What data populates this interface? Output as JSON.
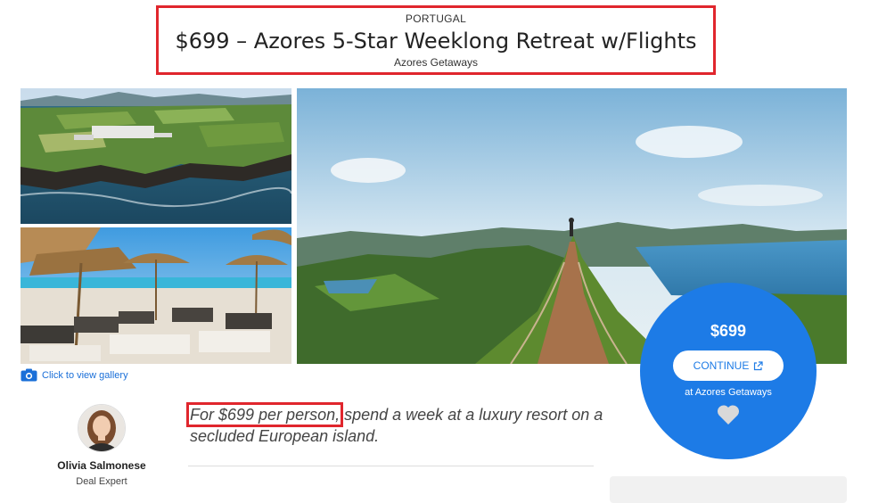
{
  "header": {
    "country": "PORTUGAL",
    "title": "$699 – Azores 5-Star Weeklong Retreat w/Flights",
    "provider": "Azores Getaways"
  },
  "gallery": {
    "link_label": "Click to view gallery",
    "icon": "camera-icon",
    "photos": [
      "aerial-coast-resort-photo",
      "pool-umbrellas-photo",
      "crater-lake-trail-photo"
    ]
  },
  "deal": {
    "price": "$699",
    "continue_label": "CONTINUE",
    "continue_icon": "external-link-icon",
    "at_label": "at Azores Getaways",
    "heart_icon": "heart-icon",
    "color": "#1d7be6"
  },
  "author": {
    "name": "Olivia Salmonese",
    "role": "Deal Expert"
  },
  "lead": {
    "highlight": "For $699 per person,",
    "rest": " spend a week at a luxury resort on a secluded European island."
  },
  "colors": {
    "highlight_border": "#e0262d",
    "link": "#1a6fd8"
  }
}
